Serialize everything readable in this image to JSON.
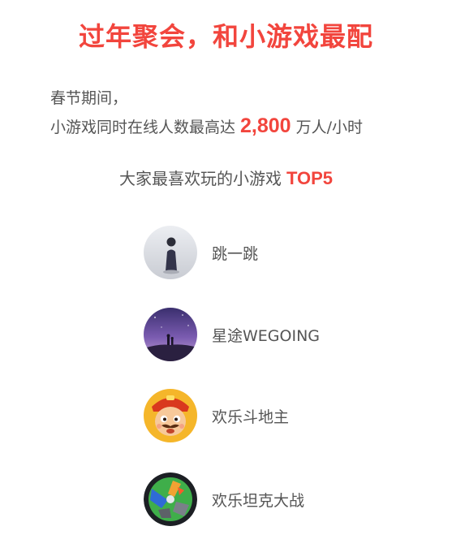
{
  "headline": "过年聚会，和小游戏最配",
  "intro": {
    "line1": "春节期间，",
    "line2_prefix": "小游戏同时在线人数最高达",
    "line2_value": "2,800",
    "line2_suffix": "万人/小时"
  },
  "section": {
    "title": "大家最喜欢玩的小游戏",
    "highlight": "TOP5"
  },
  "games": [
    {
      "name": "跳一跳",
      "icon": "tiaoyitiao-icon"
    },
    {
      "name": "星途WEGOING",
      "icon": "wegoing-icon"
    },
    {
      "name": "欢乐斗地主",
      "icon": "doudizhu-icon"
    },
    {
      "name": "欢乐坦克大战",
      "icon": "tank-icon"
    }
  ],
  "colors": {
    "accent": "#f2453d",
    "text": "#555555"
  }
}
